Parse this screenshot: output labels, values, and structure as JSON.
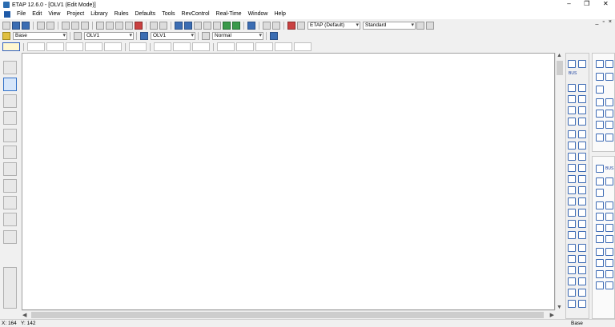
{
  "window": {
    "title": "ETAP 12.6.0 - [OLV1 (Edit Mode)]",
    "min": "–",
    "max": "❐",
    "close": "✕"
  },
  "menu": [
    "File",
    "Edit",
    "View",
    "Project",
    "Library",
    "Rules",
    "Defaults",
    "Tools",
    "RevControl",
    "Real-Time",
    "Window",
    "Help"
  ],
  "mdi": {
    "min": "_",
    "max": "▫",
    "close": "×"
  },
  "toolbar1": {
    "config_combo": "ETAP (Default)",
    "standard_combo": "Standard"
  },
  "toolbar2": {
    "presentation_combo": "Base",
    "oneline_combo": "OLV1",
    "config_combo": "OLV1",
    "mode_combo": "Normal"
  },
  "canvas": {
    "background": "#ffffff"
  },
  "scroll": {
    "up": "▲",
    "down": "▼",
    "left": "◀",
    "right": "▶"
  },
  "right_panel": {
    "bus_label": "BUS",
    "bus_label2": "BUS"
  },
  "status": {
    "x": "X: 164",
    "y": "Y: 142",
    "mode": "Base"
  }
}
